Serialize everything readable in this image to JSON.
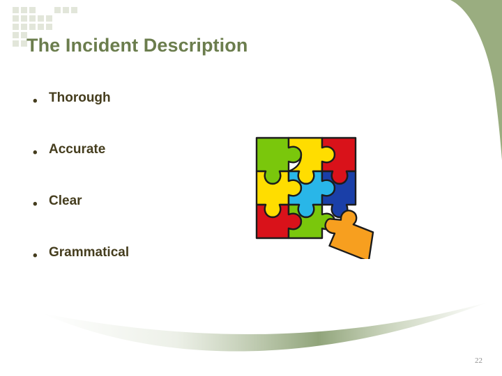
{
  "slide": {
    "title": "The Incident Description",
    "page_number": "22",
    "colors": {
      "title_green": "#6b7d4d",
      "body_olive": "#453d1e",
      "accent_green": "#9aad80",
      "dot_gray": "#e2e6da",
      "page_number_gray": "#8d8d8d"
    }
  },
  "bullets": [
    {
      "marker": "•",
      "label": "Thorough"
    },
    {
      "marker": "•",
      "label": "Accurate"
    },
    {
      "marker": "•",
      "label": "Clear"
    },
    {
      "marker": "•",
      "label": "Grammatical"
    }
  ],
  "puzzle": {
    "name": "jigsaw-puzzle-illustration",
    "grid": [
      {
        "position": "top-left",
        "color": "#7ac70c"
      },
      {
        "position": "top-center",
        "color": "#ffdd00"
      },
      {
        "position": "top-right",
        "color": "#d9121a"
      },
      {
        "position": "middle-left",
        "color": "#ffdd00"
      },
      {
        "position": "middle-center",
        "color": "#29b6e8"
      },
      {
        "position": "middle-right",
        "color": "#1a3fa8"
      },
      {
        "position": "bottom-left",
        "color": "#d9121a"
      },
      {
        "position": "bottom-center",
        "color": "#7ac70c"
      },
      {
        "position": "bottom-right",
        "color": "none"
      }
    ],
    "detached_piece": {
      "position": "detached-lower-right",
      "color": "#f79f1f"
    },
    "outline_color": "#1c1c1c"
  },
  "dot_grid": {
    "name": "decorative-dot-grid",
    "color": "#e2e6da",
    "rows": [
      [
        1,
        1,
        1,
        0,
        0,
        1,
        1,
        1
      ],
      [
        1,
        1,
        1,
        1,
        1,
        0,
        0,
        0
      ],
      [
        1,
        1,
        1,
        1,
        1,
        0,
        0,
        0
      ],
      [
        1,
        1,
        0,
        0,
        0,
        0,
        0,
        0
      ],
      [
        1,
        1,
        0,
        0,
        0,
        0,
        0,
        0
      ]
    ]
  }
}
